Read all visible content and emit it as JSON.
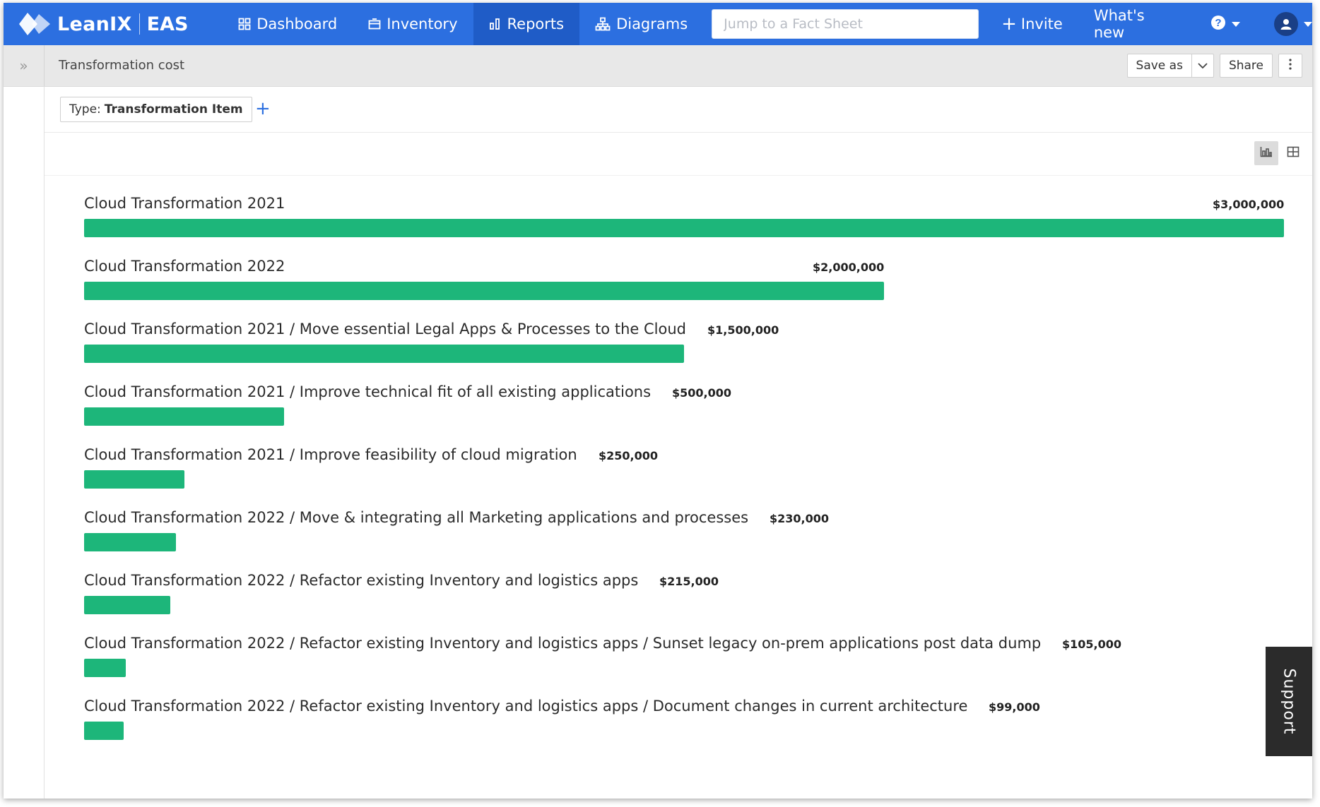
{
  "nav": {
    "brand": "LeanIX",
    "product": "EAS",
    "items": [
      {
        "label": "Dashboard",
        "icon": "dashboard-icon"
      },
      {
        "label": "Inventory",
        "icon": "inventory-icon"
      },
      {
        "label": "Reports",
        "icon": "reports-icon",
        "active": true
      },
      {
        "label": "Diagrams",
        "icon": "diagrams-icon"
      }
    ],
    "search_placeholder": "Jump to a Fact Sheet",
    "invite_label": "Invite",
    "whats_new_label": "What's new"
  },
  "subheader": {
    "expand_glyph": "»",
    "title": "Transformation cost",
    "save_as_label": "Save as",
    "share_label": "Share"
  },
  "filter": {
    "type_label": "Type:",
    "type_value": "Transformation Item",
    "add_glyph": "+"
  },
  "support_label": "Support",
  "colors": {
    "nav_bg": "#2c6fe0",
    "bar": "#1db67a"
  },
  "chart_data": {
    "type": "bar",
    "orientation": "horizontal",
    "categories": [
      "Cloud Transformation 2021",
      "Cloud Transformation 2022",
      "Cloud Transformation 2021 / Move essential Legal Apps & Processes to the Cloud",
      "Cloud Transformation 2021 / Improve technical fit of all existing applications",
      "Cloud Transformation 2021 / Improve feasibility of cloud migration",
      "Cloud Transformation 2022 / Move & integrating all Marketing applications and processes",
      "Cloud Transformation 2022 / Refactor existing Inventory and logistics apps",
      "Cloud Transformation 2022 / Refactor existing Inventory and logistics apps / Sunset legacy on-prem applications post data dump",
      "Cloud Transformation 2022 / Refactor existing Inventory and logistics apps / Document changes in current architecture"
    ],
    "values": [
      3000000,
      2000000,
      1500000,
      500000,
      250000,
      230000,
      215000,
      105000,
      99000
    ],
    "value_labels": [
      "$3,000,000",
      "$2,000,000",
      "$1,500,000",
      "$500,000",
      "$250,000",
      "$230,000",
      "$215,000",
      "$105,000",
      "$99,000"
    ],
    "xlim": [
      0,
      3000000
    ]
  }
}
